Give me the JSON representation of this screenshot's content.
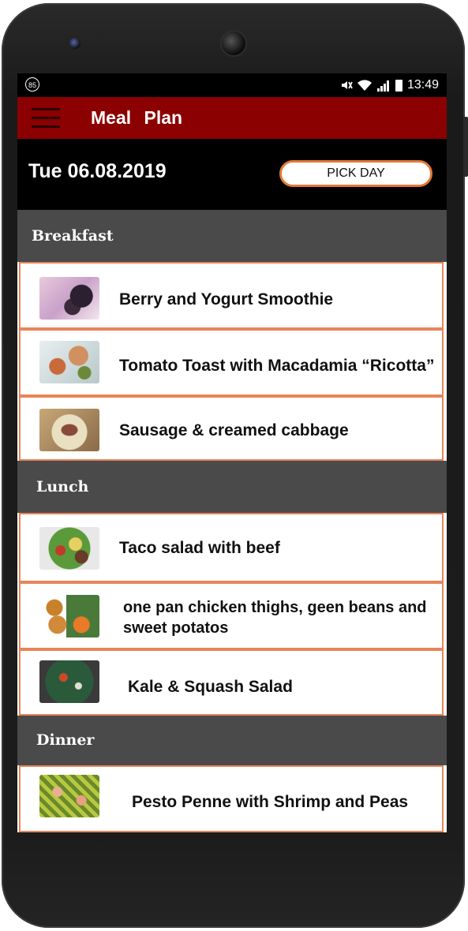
{
  "status_bar": {
    "badge": "85",
    "time": "13:49",
    "icons": [
      "mute-icon",
      "wifi-icon",
      "signal-icon",
      "battery-icon"
    ]
  },
  "app_bar": {
    "title": "Meal Plan",
    "menu_icon": "hamburger-menu-icon"
  },
  "date_bar": {
    "date": "Tue 06.08.2019",
    "pick_day_label": "PICK DAY"
  },
  "sections": {
    "breakfast": "Breakfast",
    "lunch": "Lunch",
    "dinner": "Dinner"
  },
  "meals": {
    "breakfast": [
      {
        "name": "Berry and Yogurt Smoothie"
      },
      {
        "name": "Tomato Toast with Macadamia “Ricotta”"
      },
      {
        "name": "Sausage & creamed cabbage"
      }
    ],
    "lunch": [
      {
        "name": "Taco salad with beef"
      },
      {
        "name": "one pan chicken thighs, geen beans and sweet potatos"
      },
      {
        "name": "Kale & Squash Salad"
      }
    ],
    "dinner": [
      {
        "name": "Pesto Penne with Shrimp and Peas"
      }
    ]
  },
  "colors": {
    "app_bar": "#8b0000",
    "section_header": "#4a4a4a",
    "row_border": "#e8845a",
    "pick_button_border": "#e07a35"
  }
}
